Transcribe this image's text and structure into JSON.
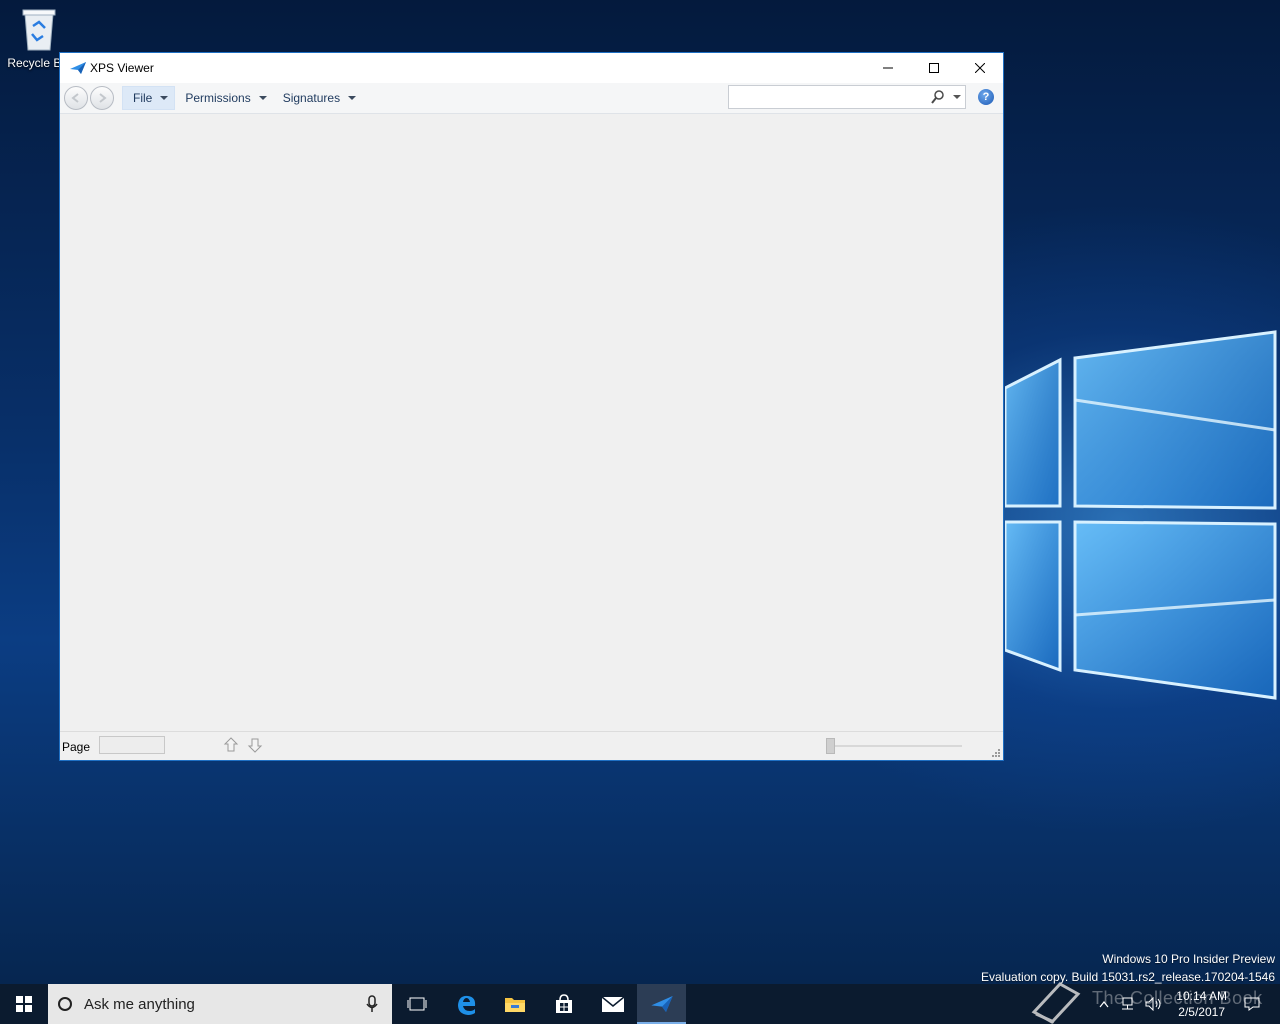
{
  "desktop": {
    "icons": [
      {
        "label": "Recycle Bin",
        "icon": "recycle-bin-icon"
      }
    ]
  },
  "window": {
    "title": "XPS Viewer",
    "app_icon": "xps-viewer-icon",
    "controls": {
      "minimize": "minimize-icon",
      "maximize": "maximize-icon",
      "close": "close-icon"
    },
    "toolbar": {
      "menus": [
        {
          "label": "File",
          "active": true
        },
        {
          "label": "Permissions",
          "active": false
        },
        {
          "label": "Signatures",
          "active": false
        }
      ],
      "search": {
        "value": "",
        "placeholder": ""
      },
      "help_label": "?"
    },
    "statusbar": {
      "page_label": "Page",
      "page_value": ""
    }
  },
  "watermark": {
    "line1": "Windows 10 Pro Insider Preview",
    "line2": "Evaluation copy. Build 15031.rs2_release.170204-1546",
    "brand": "The Collection Book"
  },
  "taskbar": {
    "search_placeholder": "Ask me anything",
    "apps": [
      "task-view-icon",
      "edge-icon",
      "file-explorer-icon",
      "store-icon",
      "mail-icon",
      "xps-viewer-icon"
    ],
    "clock": {
      "time": "10:14 AM",
      "date": "2/5/2017"
    }
  },
  "colors": {
    "accent": "#1e6fc3",
    "taskbar": "#0b1b2f",
    "window_bg": "#f0f0f0"
  }
}
